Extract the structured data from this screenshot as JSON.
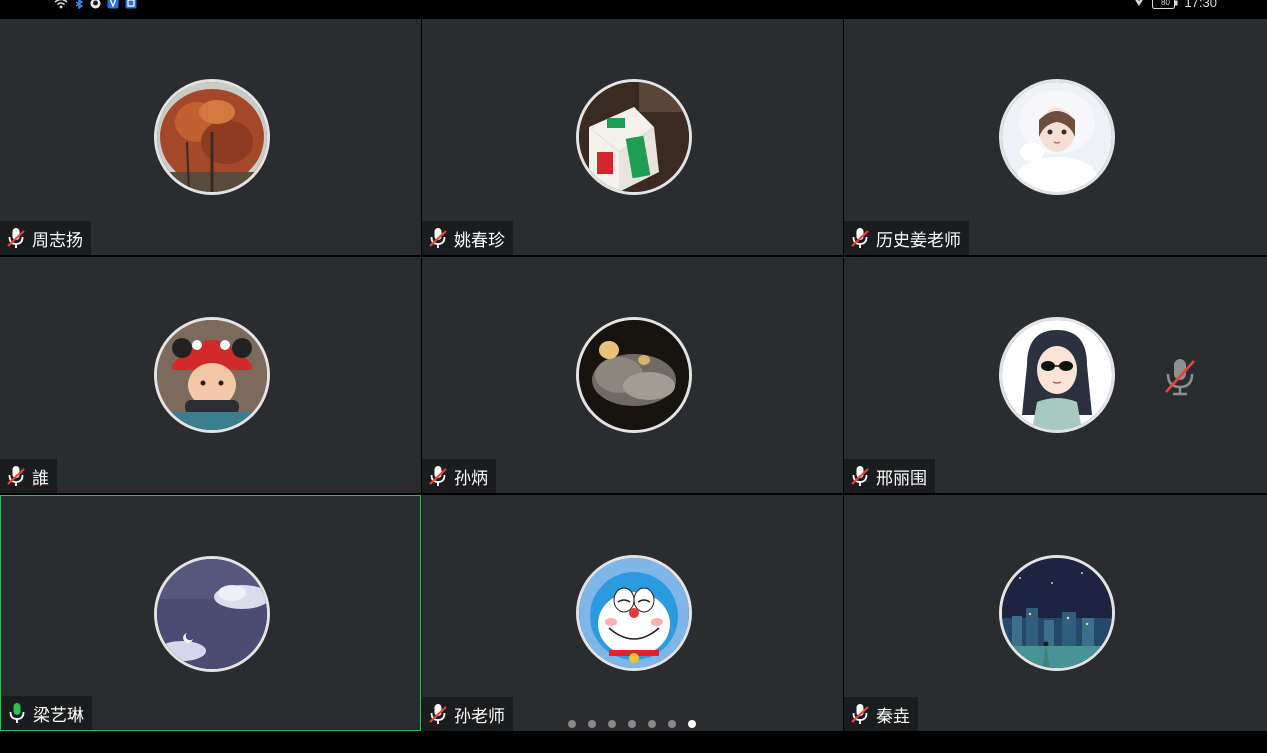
{
  "status_bar": {
    "left_icons": [
      "wifi-icon",
      "bluetooth-icon",
      "app-icon",
      "shield-app-icon",
      "notification-app-icon"
    ],
    "right_icons": [
      "location-icon",
      "battery-icon"
    ],
    "battery": "80",
    "time": "17:30"
  },
  "participants": [
    {
      "name": "周志扬",
      "avatar": "autumn-tree-photo",
      "mic": "muted",
      "active": false
    },
    {
      "name": "姚春珍",
      "avatar": "mahjong-tile-photo",
      "mic": "muted",
      "active": false
    },
    {
      "name": "历史姜老师",
      "avatar": "anime-girl-illustration",
      "mic": "muted",
      "active": false
    },
    {
      "name": "誰",
      "avatar": "child-in-red-hat-photo",
      "mic": "muted",
      "active": false
    },
    {
      "name": "孙炳",
      "avatar": "smoke-photo",
      "mic": "muted",
      "active": false
    },
    {
      "name": "邢丽围",
      "avatar": "girl-with-sunglasses-illustration",
      "mic": "muted",
      "active": false,
      "center_mute_indicator": true
    },
    {
      "name": "梁艺琳",
      "avatar": "purple-sky-clouds",
      "mic": "speaking",
      "active": true
    },
    {
      "name": "孙老师",
      "avatar": "doraemon",
      "mic": "muted",
      "active": false
    },
    {
      "name": "秦垚",
      "avatar": "night-city-illustration",
      "mic": "muted",
      "active": false
    }
  ],
  "pager": {
    "total": 7,
    "current": 7
  },
  "colors": {
    "tile_bg": "#2a2c2f",
    "active_border": "#2ebd59",
    "mic_red": "#e8453c",
    "mic_green": "#2ebd59"
  }
}
